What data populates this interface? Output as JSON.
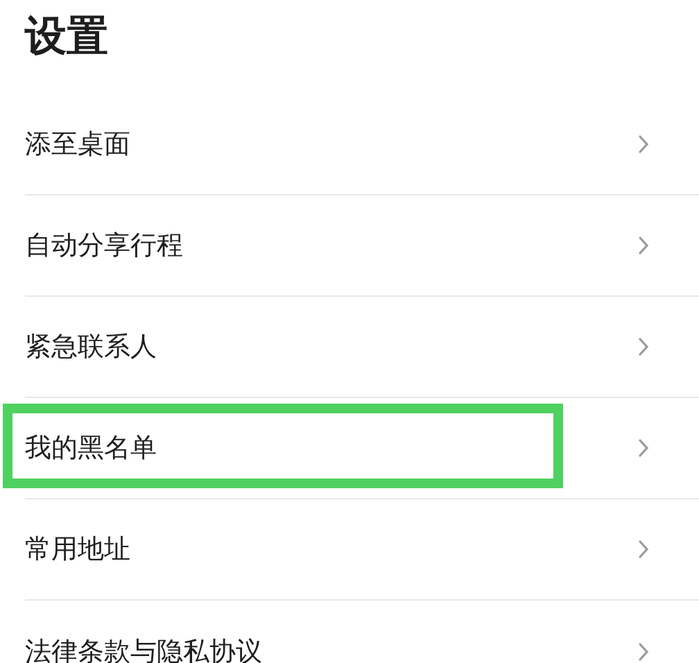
{
  "title": "设置",
  "rows": [
    {
      "label": "添至桌面",
      "highlighted": false
    },
    {
      "label": "自动分享行程",
      "highlighted": false
    },
    {
      "label": "紧急联系人",
      "highlighted": false
    },
    {
      "label": "我的黑名单",
      "highlighted": true
    },
    {
      "label": "常用地址",
      "highlighted": false
    },
    {
      "label": "法律条款与隐私协议",
      "highlighted": false
    }
  ]
}
